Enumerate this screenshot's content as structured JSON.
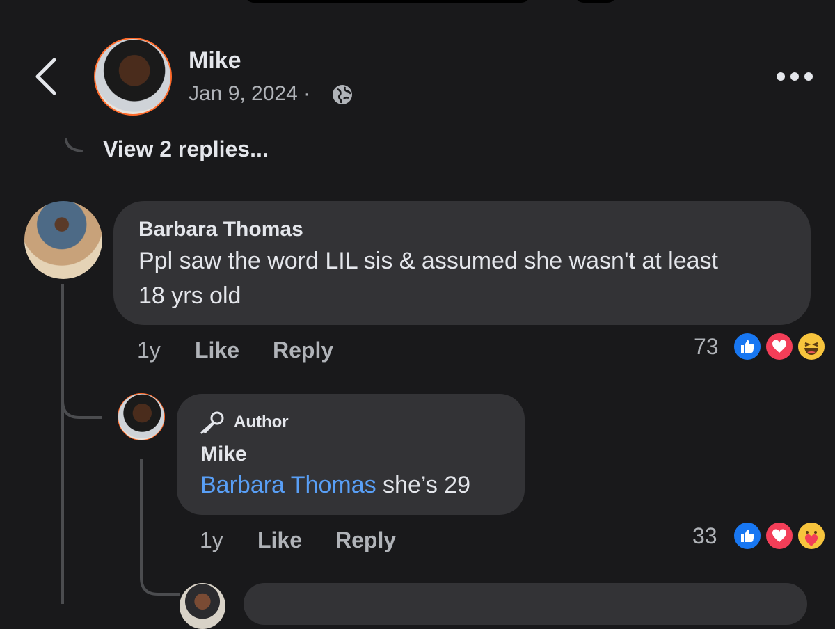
{
  "post": {
    "author": "Mike",
    "date": "Jan 9, 2024",
    "separator": "·"
  },
  "view_replies": "View 2 replies...",
  "comments": [
    {
      "name": "Barbara Thomas",
      "text_line1": "Ppl saw the word LIL sis & assumed she wasn't at least",
      "text_line2": "18 yrs old",
      "age": "1y",
      "like": "Like",
      "reply": "Reply",
      "reactions": "73"
    },
    {
      "badge": "Author",
      "name": "Mike",
      "mention": "Barbara Thomas",
      "text": " she’s 29",
      "age": "1y",
      "like": "Like",
      "reply": "Reply",
      "reactions": "33"
    }
  ],
  "icons": [
    "back-icon",
    "globe-icon",
    "more-icon",
    "microphone-icon",
    "like-reaction-icon",
    "love-reaction-icon",
    "haha-reaction-icon",
    "care-reaction-icon"
  ],
  "colors": {
    "background": "#19191b",
    "bubble": "#333336",
    "mention": "#599ff6",
    "like": "#1877f2",
    "love": "#f33e58",
    "author_ring": "#ff6a2a"
  }
}
